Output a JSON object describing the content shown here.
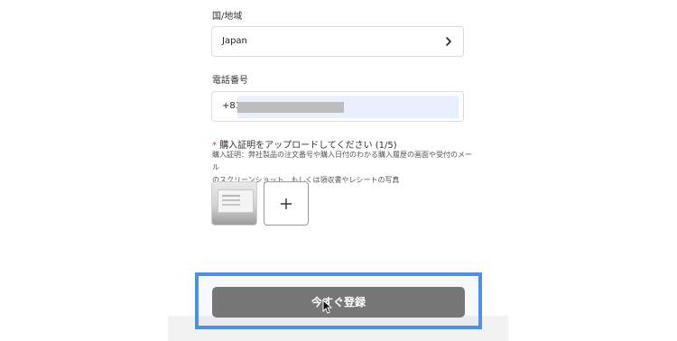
{
  "country": {
    "label": "国/地域",
    "value": "Japan"
  },
  "phone": {
    "label": "電話番号",
    "country_code": "+81"
  },
  "upload": {
    "required_mark": "*",
    "label": "購入証明をアップロードしてください (1/5)",
    "hint_line1": "購入証明：弊社製品の注文番号や購入日付のわかる購入履歴の画面や受付のメール",
    "hint_line2": "のスクリーンショット、もしくは領収書やレシートの写真"
  },
  "submit": {
    "label": "今すぐ登録"
  },
  "icons": {
    "chevron": "chevron-right-icon",
    "plus": "plus-icon",
    "cursor": "mouse-cursor-icon"
  },
  "colors": {
    "button": "#777777",
    "highlight": "#4f8fe6",
    "autofill": "#e8f0fe",
    "required": "#e0303a"
  }
}
